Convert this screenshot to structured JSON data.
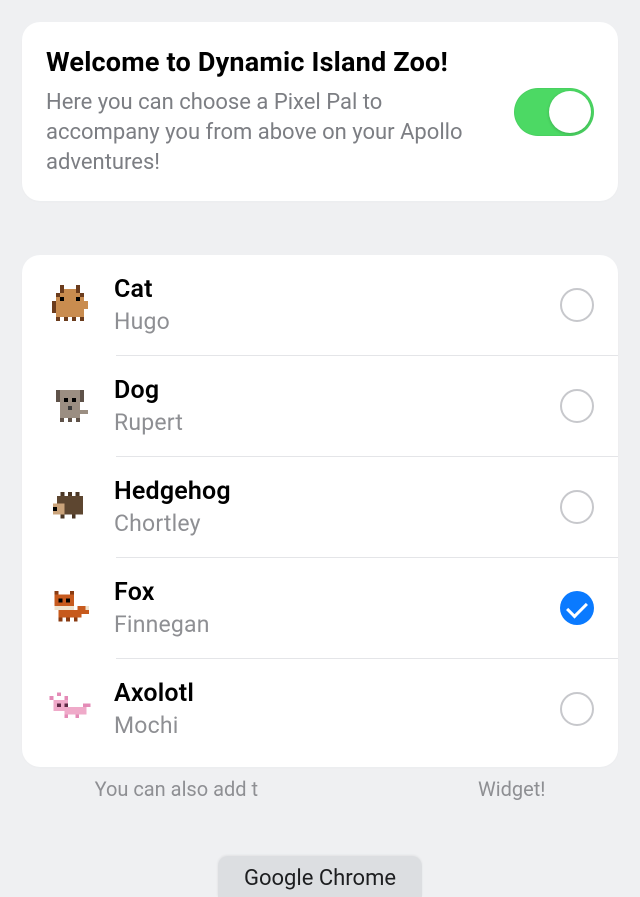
{
  "header": {
    "title": "Welcome to Dynamic Island Zoo!",
    "subtitle": "Here you can choose a Pixel Pal to accompany you from above on your Apollo adventures!",
    "toggle_on": true
  },
  "pets": [
    {
      "species": "Cat",
      "name": "Hugo",
      "icon": "cat-icon",
      "selected": false
    },
    {
      "species": "Dog",
      "name": "Rupert",
      "icon": "dog-icon",
      "selected": false
    },
    {
      "species": "Hedgehog",
      "name": "Chortley",
      "icon": "hedgehog-icon",
      "selected": false
    },
    {
      "species": "Fox",
      "name": "Finnegan",
      "icon": "fox-icon",
      "selected": true
    },
    {
      "species": "Axolotl",
      "name": "Mochi",
      "icon": "axolotl-icon",
      "selected": false
    }
  ],
  "footer_left": "You can also add t",
  "footer_right": "Widget!",
  "browser_pill": "Google Chrome"
}
